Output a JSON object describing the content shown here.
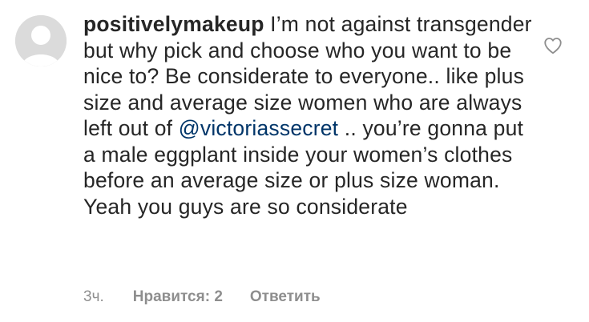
{
  "comment": {
    "username": "positivelymakeup",
    "text_part1": " I’m not against transgender but why pick and choose who you want to be nice to? Be considerate to everyone.. like plus size and average size women who are always left out of ",
    "mention": "@victoriassecret",
    "text_part2": " .. you’re gonna put a male eggplant inside your women’s clothes before an average size or plus size woman. Yeah you guys are so considerate",
    "time": "3ч.",
    "likes_label": "Нравится: 2",
    "reply_label": "Ответить"
  },
  "icons": {
    "avatar": "default-avatar-icon",
    "like": "heart-outline-icon"
  },
  "colors": {
    "text": "#262626",
    "mention": "#003569",
    "meta": "#8e8e8e",
    "avatar_bg": "#dbdbdb"
  }
}
